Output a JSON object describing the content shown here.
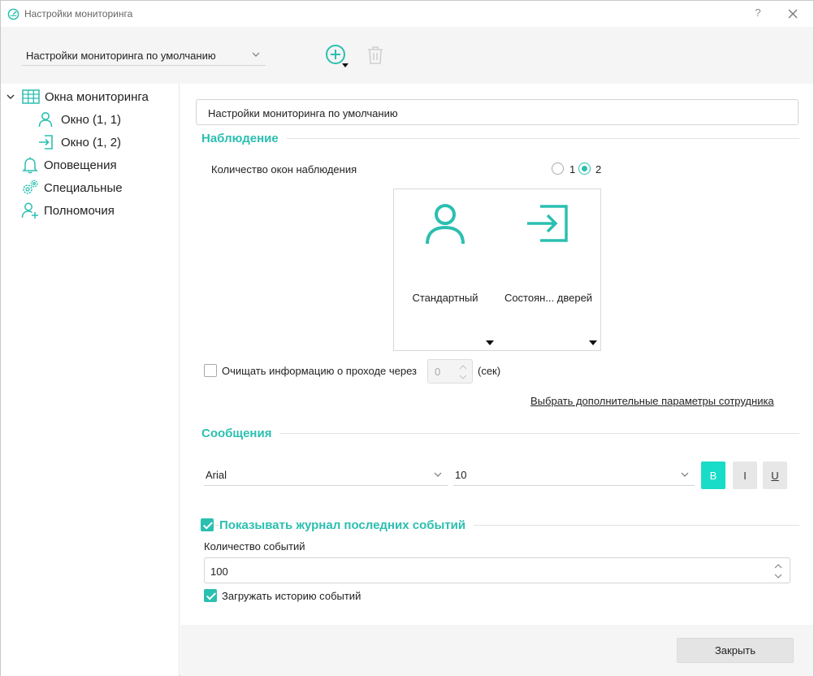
{
  "window": {
    "title": "Настройки мониторинга",
    "help_label": "?"
  },
  "toolbar": {
    "profile_value": "Настройки мониторинга по умолчанию"
  },
  "sidebar": {
    "items": [
      {
        "label": "Окна мониторинга",
        "icon": "grid-icon"
      },
      {
        "label": "Окно (1, 1)",
        "icon": "person-icon"
      },
      {
        "label": "Окно (1, 2)",
        "icon": "door-enter-icon"
      },
      {
        "label": "Оповещения",
        "icon": "bell-icon"
      },
      {
        "label": "Специальные",
        "icon": "gears-icon"
      },
      {
        "label": "Полномочия",
        "icon": "user-add-icon"
      }
    ]
  },
  "main": {
    "name_value": "Настройки мониторинга по умолчанию",
    "observation": {
      "title": "Наблюдение",
      "count_label": "Количество окон наблюдения",
      "radio_options": [
        "1",
        "2"
      ],
      "selected": "2",
      "cells": [
        {
          "label": "Стандартный",
          "icon": "person-icon"
        },
        {
          "label": "Состоян... дверей",
          "icon": "door-enter-icon"
        }
      ],
      "clear_label": "Очищать информацию о проходе через",
      "clear_value": "0",
      "clear_unit": "(сек)",
      "extra_link": "Выбрать дополнительные параметры сотрудника"
    },
    "messages": {
      "title": "Сообщения",
      "font": "Arial",
      "size": "10",
      "bold": "B",
      "italic": "I",
      "underline": "U"
    },
    "journal": {
      "title": "Показывать журнал последних событий",
      "count_label": "Количество событий",
      "count_value": "100",
      "load_history_label": "Загружать историю событий"
    }
  },
  "footer": {
    "close_label": "Закрыть"
  },
  "colors": {
    "accent": "#2bbfb0",
    "bold_active": "#19dcc8"
  }
}
